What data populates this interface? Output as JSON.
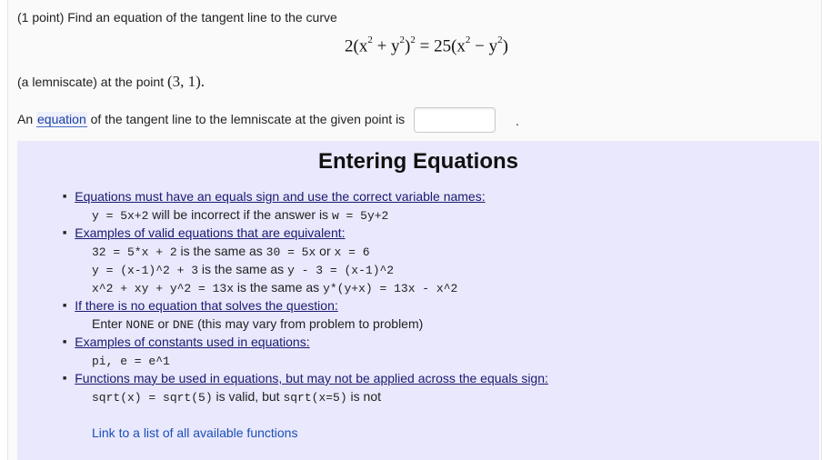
{
  "problem": {
    "intro": "(1 point) Find an equation of the tangent line to the curve",
    "lemniscate_text": "(a lemniscate) at the point",
    "point": "(3, 1).",
    "answer_prefix": "An ",
    "answer_link": "equation",
    "answer_suffix": " of the tangent line to the lemniscate at the given point is",
    "answer_value": "",
    "period": "."
  },
  "help": {
    "title": "Entering Equations",
    "b1": "Equations must have an equals sign and use the correct variable names:",
    "b1_code1": "y = 5x+2",
    "b1_text": " will be incorrect if the answer is ",
    "b1_code2": "w = 5y+2",
    "b2": "Examples of valid equations that are equivalent:",
    "b2_l1_a": "32 = 5*x + 2",
    "b2_l1_t1": " is the same as ",
    "b2_l1_b": "30 = 5x",
    "b2_l1_t2": " or ",
    "b2_l1_c": "x = 6",
    "b2_l2_a": "y = (x-1)^2 + 3",
    "b2_l2_t": " is the same as ",
    "b2_l2_b": "y - 3 = (x-1)^2",
    "b2_l3_a": "x^2 + xy + y^2 = 13x",
    "b2_l3_t": " is the same as ",
    "b2_l3_b": "y*(y+x) = 13x - x^2",
    "b3": "If there is no equation that solves the question:",
    "b3_t1": "Enter ",
    "b3_c1": "NONE",
    "b3_t2": " or ",
    "b3_c2": "DNE",
    "b3_t3": " (this may vary from problem to problem)",
    "b4": "Examples of constants used in equations:",
    "b4_code": "pi, e = e^1",
    "b5": "Functions may be used in equations, but may not be applied across the equals sign:",
    "b5_c1": "sqrt(x) = sqrt(5)",
    "b5_t1": " is valid, but ",
    "b5_c2": "sqrt(x=5)",
    "b5_t2": " is not",
    "link": "Link to a list of all available functions"
  }
}
